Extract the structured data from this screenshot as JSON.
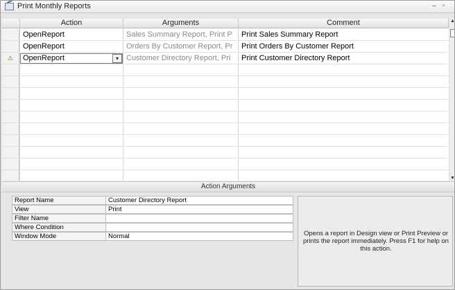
{
  "window": {
    "title": "Print Monthly Reports",
    "minimize_glyph": "–",
    "restore_glyph": "▫"
  },
  "grid": {
    "columns": [
      "Action",
      "Arguments",
      "Comment"
    ],
    "rows": [
      {
        "action": "OpenReport",
        "arguments": "Sales Summary Report, Print P",
        "comment": "Print Sales Summary Report"
      },
      {
        "action": "OpenReport",
        "arguments": "Orders By Customer Report, Pr",
        "comment": "Print Orders By Customer Report"
      },
      {
        "action": "OpenReport",
        "arguments": "Customer Directory Report, Pri",
        "comment": "Print Customer Directory Report"
      }
    ],
    "current_row_marker": "⚠",
    "combo_glyph": "▾"
  },
  "action_arguments": {
    "title": "Action Arguments",
    "properties": [
      {
        "label": "Report Name",
        "value": "Customer Directory Report"
      },
      {
        "label": "View",
        "value": "Print"
      },
      {
        "label": "Filter Name",
        "value": ""
      },
      {
        "label": "Where Condition",
        "value": ""
      },
      {
        "label": "Window Mode",
        "value": "Normal"
      }
    ],
    "help_text": "Opens a report in Design view or Print Preview or prints the report immediately. Press F1 for help on this action."
  },
  "colors": {
    "background": "#e6e6e6",
    "grid_background": "#ffffff",
    "argument_text": "#8a8a8a"
  }
}
